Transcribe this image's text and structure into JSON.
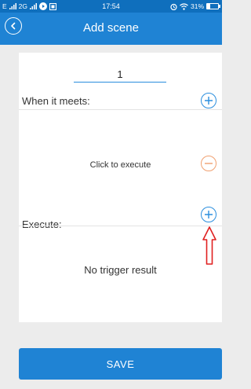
{
  "status_bar": {
    "carrier_left": "E",
    "network_2g": "2G",
    "time": "17:54",
    "battery": "31%",
    "battery_level": 0.31
  },
  "header": {
    "title": "Add scene",
    "back_icon": "back-arrow-icon"
  },
  "form": {
    "scene_name_value": "1",
    "when_label": "When it meets:",
    "click_to_execute": "Click to execute",
    "execute_label": "Execute:",
    "no_trigger_result": "No trigger result"
  },
  "save_button": {
    "label": "SAVE"
  },
  "colors": {
    "primary": "#1f83d4",
    "status_bar": "#0f6fbd",
    "add_icon": "#2a8ede",
    "remove_icon": "#f0a070",
    "annotation_arrow": "#e02020"
  }
}
